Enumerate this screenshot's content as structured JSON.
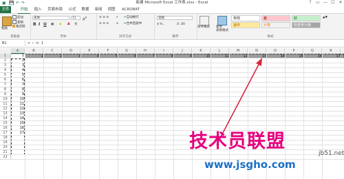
{
  "titlebar": {
    "title": "新建 Microsoft Excel 工作表.xlsx - Excel",
    "window_controls": [
      "?",
      "▭",
      "—",
      "☐",
      "✕"
    ]
  },
  "menu": {
    "tabs": [
      "文件",
      "开始",
      "插入",
      "页面布局",
      "公式",
      "数据",
      "审阅",
      "视图",
      "ACROBAT"
    ]
  },
  "ribbon": {
    "clipboard": {
      "cut": "剪切",
      "copy": "复制",
      "painter": "格式刷",
      "paste": "粘贴",
      "label": "剪贴板"
    },
    "font": {
      "name": "宋体",
      "size": "11",
      "label": "字体"
    },
    "alignment": {
      "wrap": "自动换行",
      "merge": "合并后居中",
      "label": "对齐方式"
    },
    "number": {
      "format": "常规",
      "label": "数字"
    },
    "styles": {
      "conditional": "条件格式",
      "table_format": "套用\n表格格式",
      "cells": [
        {
          "text": "常规",
          "bg": "#ffffff",
          "color": "#333333"
        },
        {
          "text": "差",
          "bg": "#ffc7ce",
          "color": "#9c0006"
        },
        {
          "text": "好",
          "bg": "#c6efce",
          "color": "#006100"
        },
        {
          "text": "适中",
          "bg": "#ffeb9c",
          "color": "#9c5700"
        },
        {
          "text": "计算",
          "bg": "#f2f2f2",
          "color": "#fa7d00"
        },
        {
          "text": "检查单元格",
          "bg": "#a5a5a5",
          "color": "#ffffff"
        }
      ],
      "label": "样式"
    }
  },
  "formula_bar": {
    "name_box": "B1",
    "fx": "fx",
    "value": "1"
  },
  "grid": {
    "columns": [
      "A",
      "B",
      "C",
      "D",
      "E",
      "F",
      "G",
      "H",
      "I",
      "J",
      "K",
      "L",
      "M",
      "N",
      "O",
      "P",
      "Q",
      "R"
    ],
    "selected_column": "A",
    "rows": [
      "1",
      "2",
      "3",
      "4",
      "5",
      "6",
      "7",
      "8",
      "9",
      "10",
      "11",
      "12",
      "13",
      "14",
      "15",
      "16",
      "17",
      "18",
      "19",
      "20",
      "21",
      "22"
    ],
    "selected_row": "1",
    "row1_values": [
      "1",
      "2",
      "3",
      "4",
      "5",
      "6",
      "7",
      "8",
      "9",
      "10",
      "11",
      "12",
      "13",
      "14",
      "15",
      "16",
      "17"
    ],
    "colA_values": [
      "1",
      "2",
      "3",
      "4",
      "5",
      "6",
      "7",
      "8",
      "9",
      "10",
      "11",
      "12",
      "13",
      "14",
      "15",
      "16",
      "17"
    ]
  },
  "watermark": {
    "big_text": "技术员联盟",
    "url": "www.jsgho.com",
    "side_text": "jb51.net"
  },
  "colors": {
    "excel_green": "#217346",
    "arrow_red": "#d7263d",
    "watermark_pink": "#e6007e",
    "watermark_blue": "#1c70c6"
  }
}
